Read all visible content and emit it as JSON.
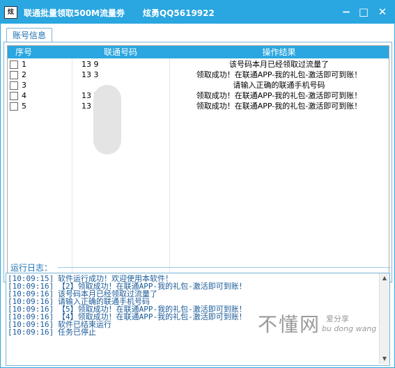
{
  "window": {
    "icon_text": "炫勇",
    "title": "联通批量领取500M流量劵",
    "author": "炫勇QQ5619922",
    "min_glyph": "−",
    "max_glyph": "□",
    "close_glyph": "✕"
  },
  "tab": {
    "label": "账号信息"
  },
  "table": {
    "headers": [
      "序号",
      "联通号码",
      "操作结果"
    ],
    "rows": [
      {
        "idx": "1",
        "phone": "13       9",
        "result": "该号码本月已经领取过流量了"
      },
      {
        "idx": "2",
        "phone": "13       3",
        "result": "领取成功！在联通APP-我的礼包-激活即可到账！"
      },
      {
        "idx": "3",
        "phone": "",
        "result": "请输入正确的联通手机号码"
      },
      {
        "idx": "4",
        "phone": "13       2",
        "result": "领取成功！在联通APP-我的礼包-激活即可到账！"
      },
      {
        "idx": "5",
        "phone": "13       1",
        "result": "领取成功！在联通APP-我的礼包-激活即可到账！"
      }
    ]
  },
  "log": {
    "label": "运行日志：",
    "lines": [
      {
        "time": "[10:09:15]",
        "msg": "软件运行成功！欢迎使用本软件！"
      },
      {
        "time": "[10:09:16]",
        "msg": "【2】领取成功！在联通APP-我的礼包-激活即可到账！"
      },
      {
        "time": "[10:09:16]",
        "msg": "该号码本月已经领取过流量了"
      },
      {
        "time": "[10:09:16]",
        "msg": "请输入正确的联通手机号码"
      },
      {
        "time": "[10:09:16]",
        "msg": "【5】领取成功！在联通APP-我的礼包-激活即可到账！"
      },
      {
        "time": "[10:09:16]",
        "msg": "【4】领取成功！在联通APP-我的礼包-激活即可到账！"
      },
      {
        "time": "[10:09:16]",
        "msg": "软件已结束运行"
      },
      {
        "time": "[10:09:16]",
        "msg": "任务已停止"
      }
    ]
  },
  "watermark": {
    "main": "不懂网",
    "sub": "爱分享",
    "pinyin": "bu dong wang"
  }
}
